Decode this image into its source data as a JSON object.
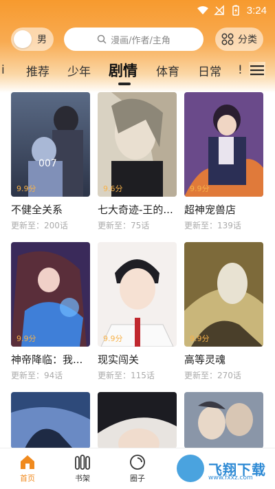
{
  "status_bar": {
    "time": "3:24"
  },
  "header": {
    "gender_label": "男",
    "search_placeholder": "漫画/作者/主角",
    "category_label": "分类"
  },
  "tabs": [
    {
      "label": "i"
    },
    {
      "label": "推荐"
    },
    {
      "label": "少年"
    },
    {
      "label": "剧情",
      "active": true
    },
    {
      "label": "体育"
    },
    {
      "label": "日常"
    },
    {
      "label": "!"
    }
  ],
  "comics": [
    {
      "title": "不健全关系",
      "rating": "9.9分",
      "update": "更新至：200话",
      "cover_text": "007"
    },
    {
      "title": "七大奇迹-王的...",
      "rating": "9.6分",
      "update": "更新至：75话"
    },
    {
      "title": "超神宠兽店",
      "rating": "9.9分",
      "update": "更新至：139话"
    },
    {
      "title": "神帝降临：我...",
      "rating": "9.9分",
      "update": "更新至：94话"
    },
    {
      "title": "现实闯关",
      "rating": "9.9分",
      "update": "更新至：115话"
    },
    {
      "title": "高等灵魂",
      "rating": "9.9分",
      "update": "更新至：270话"
    },
    {
      "title": "",
      "rating": "",
      "update": ""
    },
    {
      "title": "",
      "rating": "",
      "update": ""
    },
    {
      "title": "",
      "rating": "",
      "update": ""
    }
  ],
  "bottom_nav": [
    {
      "label": "首页",
      "icon": "home-icon",
      "active": true
    },
    {
      "label": "书架",
      "icon": "bookshelf-icon"
    },
    {
      "label": "圈子",
      "icon": "circle-icon"
    }
  ],
  "watermark": {
    "text": "飞翔下载",
    "url": "www.fxxz.com"
  },
  "colors": {
    "accent": "#f08a1e",
    "rating": "#f7b24a",
    "header": "#f79a2e"
  }
}
